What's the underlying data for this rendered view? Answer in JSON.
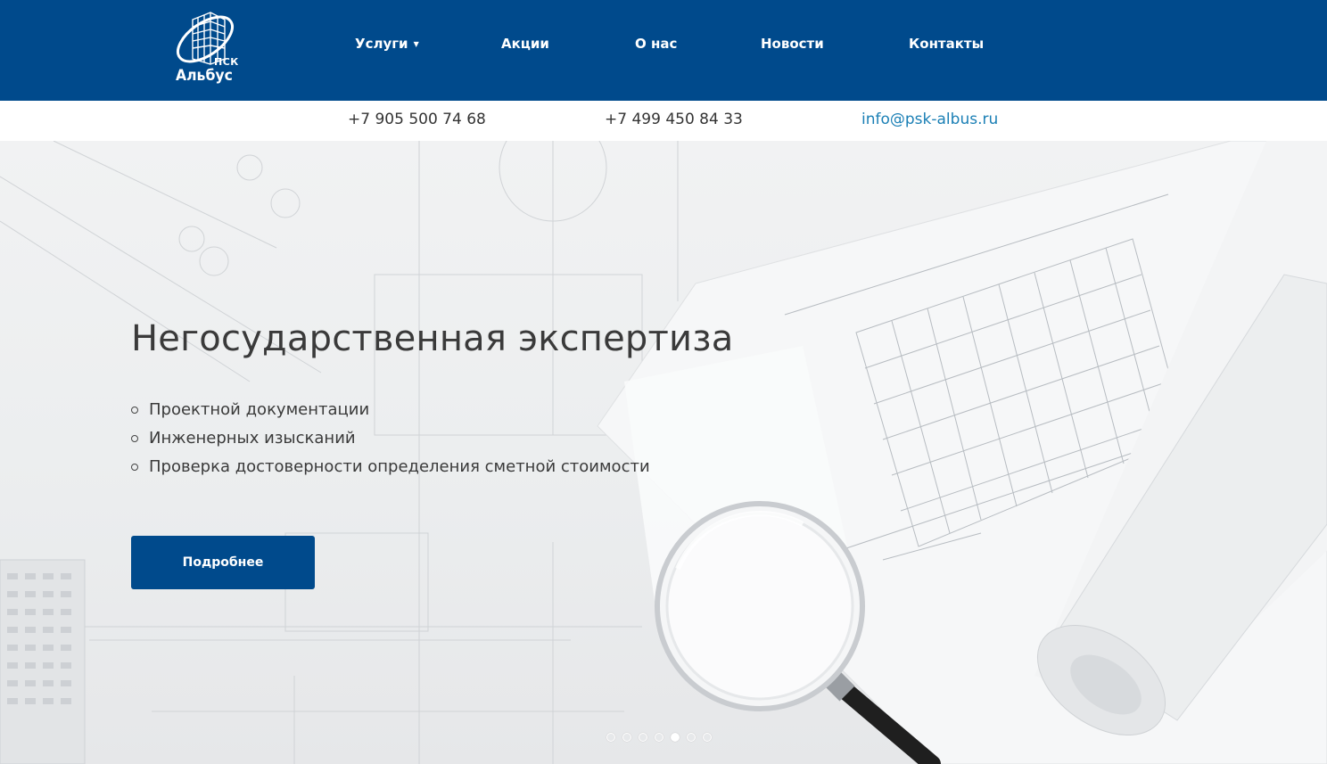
{
  "header": {
    "logo": {
      "abbr": "ПСК",
      "name": "Альбус"
    },
    "nav": [
      {
        "label": "Услуги",
        "has_dropdown": true
      },
      {
        "label": "Акции"
      },
      {
        "label": "О нас"
      },
      {
        "label": "Новости"
      },
      {
        "label": "Контакты"
      }
    ]
  },
  "contacts": {
    "phone_1": "+7 905 500 74 68",
    "phone_2": "+7 499 450 84 33",
    "email": "info@psk-albus.ru"
  },
  "hero": {
    "title": "Негосударственная экспертиза",
    "items": [
      "Проектной документации",
      "Инженерных изысканий",
      "Проверка достоверности определения сметной стоимости"
    ],
    "button_label": "Подробнее",
    "slides_total": 7,
    "active_slide": 5
  },
  "colors": {
    "brand_blue": "#004a8c",
    "email_link": "#1a7fb5",
    "text_dark": "#3a3a3a"
  }
}
